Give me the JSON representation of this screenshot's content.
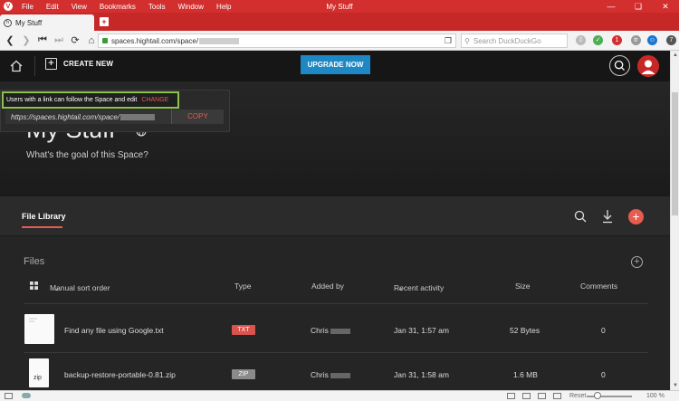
{
  "browser": {
    "menu": [
      "File",
      "Edit",
      "View",
      "Bookmarks",
      "Tools",
      "Window",
      "Help"
    ],
    "window_title": "My Stuff",
    "tab_title": "My Stuff",
    "url_prefix": "spaces.hightail.com/space/",
    "search_placeholder": "Search DuckDuckGo",
    "ext_badge_count": "1",
    "ext_badge_count2": "7"
  },
  "header": {
    "create_new": "CREATE NEW",
    "upgrade": "UPGRADE NOW"
  },
  "space": {
    "title": "My Stuff",
    "goal_placeholder": "What's the goal of this Space?"
  },
  "share": {
    "message": "Users with a link can follow the Space and edit",
    "change": "CHANGE",
    "link_prefix": "https://spaces.hightail.com/space/",
    "copy": "COPY"
  },
  "library": {
    "tab": "File Library"
  },
  "files": {
    "title": "Files",
    "columns": {
      "sort": "Manual sort order",
      "type": "Type",
      "added_by": "Added by",
      "recent": "Recent activity",
      "size": "Size",
      "comments": "Comments"
    },
    "rows": [
      {
        "name": "Find any file using Google.txt",
        "type": "TXT",
        "type_color": "#d9534f",
        "added_by": "Chris",
        "recent": "Jan 31, 1:57 am",
        "size": "52 Bytes",
        "comments": "0"
      },
      {
        "name": "backup-restore-portable-0.81.zip",
        "type": "ZIP",
        "type_color": "#8a8a8a",
        "thumb_label": "zip",
        "added_by": "Chris",
        "recent": "Jan 31, 1:58 am",
        "size": "1.6 MB",
        "comments": "0"
      }
    ]
  },
  "status": {
    "reset": "Reset",
    "zoom": "100 %"
  }
}
